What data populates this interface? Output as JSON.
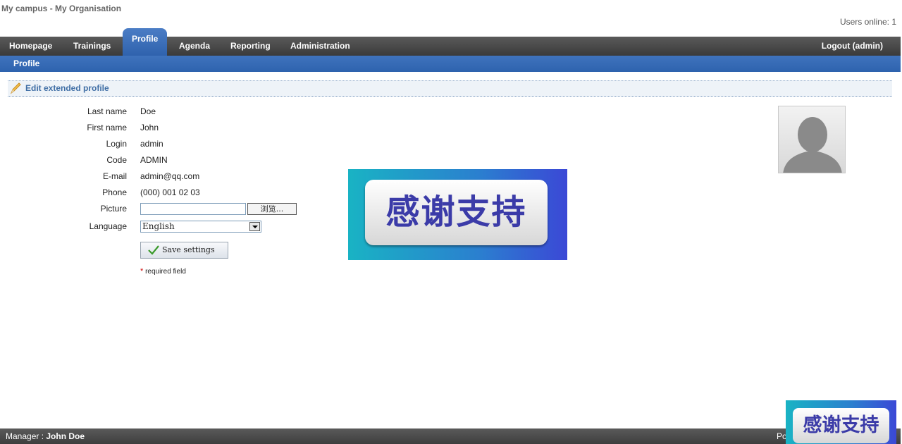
{
  "header": {
    "campus": "My campus",
    "separator": "-",
    "organisation": "My Organisation",
    "users_online": "Users online: 1"
  },
  "nav": {
    "tabs": [
      {
        "label": "Homepage",
        "active": false
      },
      {
        "label": "Trainings",
        "active": false
      },
      {
        "label": "Profile",
        "active": true
      },
      {
        "label": "Agenda",
        "active": false
      },
      {
        "label": "Reporting",
        "active": false
      },
      {
        "label": "Administration",
        "active": false
      }
    ],
    "logout": "Logout (admin)"
  },
  "subnav": {
    "items": [
      {
        "label": "Profile"
      }
    ]
  },
  "section": {
    "title": "Edit extended profile",
    "icon": "pencil-icon"
  },
  "form": {
    "fields": [
      {
        "label": "Last name",
        "value": "Doe"
      },
      {
        "label": "First name",
        "value": "John"
      },
      {
        "label": "Login",
        "value": "admin"
      },
      {
        "label": "Code",
        "value": "ADMIN"
      },
      {
        "label": "E-mail",
        "value": "admin@qq.com"
      },
      {
        "label": "Phone",
        "value": "(000) 001 02 03"
      }
    ],
    "picture_label": "Picture",
    "browse_label": "浏览...",
    "language_label": "Language",
    "language_value": "English",
    "save_label": "Save settings",
    "required_star": "*",
    "required_text": "required field"
  },
  "overlay": {
    "banner_text": "感谢支持"
  },
  "footer": {
    "manager_prefix": "Manager : ",
    "manager_name": "John Doe",
    "right_text": "Po"
  },
  "colors": {
    "nav_bg": "#4a4a4a",
    "accent_blue": "#3468b3",
    "section_text": "#3f6ea5",
    "required": "#cc0000"
  }
}
